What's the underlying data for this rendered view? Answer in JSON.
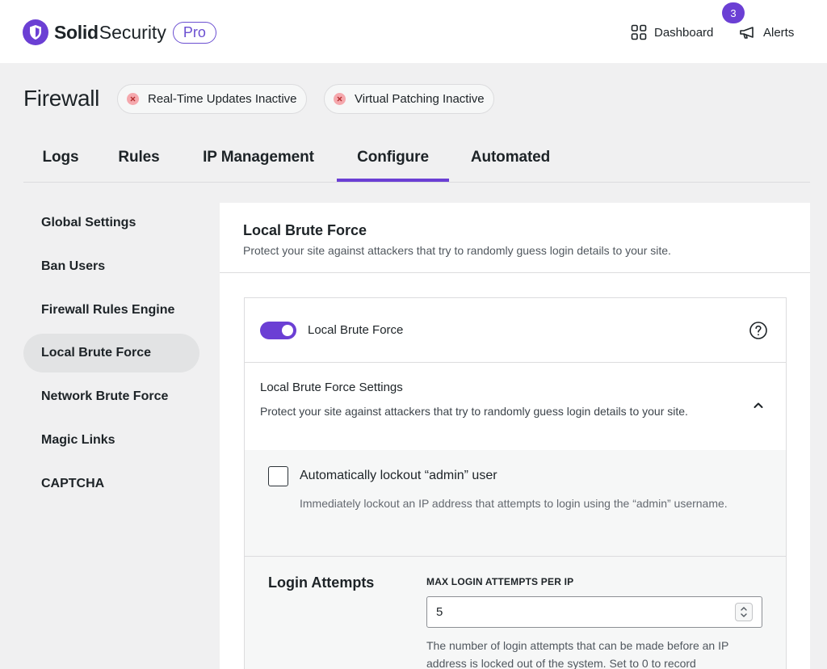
{
  "header": {
    "brand_strong": "Solid",
    "brand_light": "Security",
    "brand_badge": "Pro",
    "dashboard_label": "Dashboard",
    "alerts_label": "Alerts",
    "alerts_count": "3",
    "accent_color": "#6b3fd4"
  },
  "page": {
    "title": "Firewall",
    "status_pills": [
      {
        "label": "Real-Time Updates Inactive",
        "icon": "x-circle-icon",
        "color": "#f5a8ad"
      },
      {
        "label": "Virtual Patching Inactive",
        "icon": "x-circle-icon",
        "color": "#f5a8ad"
      }
    ]
  },
  "tabs": [
    {
      "label": "Logs",
      "active": false
    },
    {
      "label": "Rules",
      "active": false
    },
    {
      "label": "IP Management",
      "active": false
    },
    {
      "label": "Configure",
      "active": true
    },
    {
      "label": "Automated",
      "active": false
    }
  ],
  "sidebar": {
    "items": [
      {
        "label": "Global Settings",
        "active": false
      },
      {
        "label": "Ban Users",
        "active": false
      },
      {
        "label": "Firewall Rules Engine",
        "active": false
      },
      {
        "label": "Local Brute Force",
        "active": true
      },
      {
        "label": "Network Brute Force",
        "active": false
      },
      {
        "label": "Magic Links",
        "active": false
      },
      {
        "label": "CAPTCHA",
        "active": false
      }
    ]
  },
  "panel": {
    "title": "Local Brute Force",
    "description": "Protect your site against attackers that try to randomly guess login details to your site.",
    "toggle": {
      "label": "Local Brute Force",
      "enabled": true,
      "help_icon": "question-circle-icon"
    },
    "settings_section": {
      "title": "Local Brute Force Settings",
      "description": "Protect your site against attackers that try to randomly guess login details to your site.",
      "expanded": true,
      "chevron_icon": "chevron-up-icon"
    },
    "lockout_admin": {
      "label": "Automatically lockout “admin” user",
      "description": "Immediately lockout an IP address that attempts to login using the “admin” username.",
      "checked": false
    },
    "login_attempts": {
      "title": "Login Attempts",
      "field_label": "MAX LOGIN ATTEMPTS PER IP",
      "value": "5",
      "help": "The number of login attempts that can be made before an IP address is locked out of the system. Set to 0 to record"
    }
  }
}
